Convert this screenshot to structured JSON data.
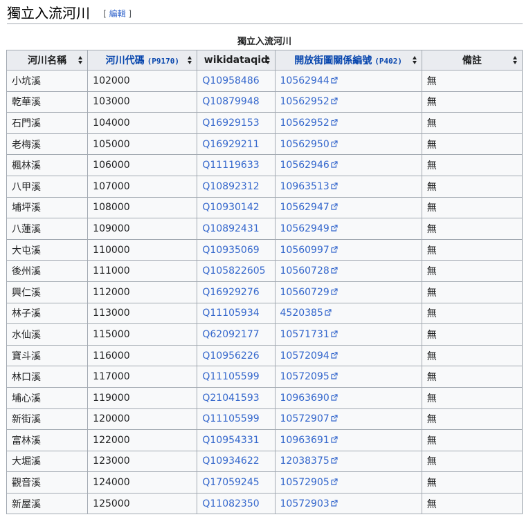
{
  "heading": {
    "title": "獨立入流河川",
    "edit_open": "[ ",
    "edit_label": "編輯",
    "edit_close": " ]"
  },
  "table": {
    "caption": "獨立入流河川",
    "headers": [
      {
        "label": "河川名稱",
        "code": ""
      },
      {
        "label": "河川代碼",
        "code": "(P9170)"
      },
      {
        "label": "wikidataqid",
        "code": ""
      },
      {
        "label": "開放街圖關係編號",
        "code": "(P402)"
      },
      {
        "label": "備註",
        "code": ""
      }
    ],
    "rows": [
      {
        "name": "小坑溪",
        "code": "102000",
        "qid": "Q10958486",
        "osm": "10562944",
        "note": "無"
      },
      {
        "name": "乾華溪",
        "code": "103000",
        "qid": "Q10879948",
        "osm": "10562952",
        "note": "無"
      },
      {
        "name": "石門溪",
        "code": "104000",
        "qid": "Q16929153",
        "osm": "10562952",
        "note": "無"
      },
      {
        "name": "老梅溪",
        "code": "105000",
        "qid": "Q16929211",
        "osm": "10562950",
        "note": "無"
      },
      {
        "name": "楓林溪",
        "code": "106000",
        "qid": "Q11119633",
        "osm": "10562946",
        "note": "無"
      },
      {
        "name": "八甲溪",
        "code": "107000",
        "qid": "Q10892312",
        "osm": "10963513",
        "note": "無"
      },
      {
        "name": "埔坪溪",
        "code": "108000",
        "qid": "Q10930142",
        "osm": "10562947",
        "note": "無"
      },
      {
        "name": "八蓮溪",
        "code": "109000",
        "qid": "Q10892431",
        "osm": "10562949",
        "note": "無"
      },
      {
        "name": "大屯溪",
        "code": "110000",
        "qid": "Q10935069",
        "osm": "10560997",
        "note": "無"
      },
      {
        "name": "後州溪",
        "code": "111000",
        "qid": "Q105822605",
        "osm": "10560728",
        "note": "無"
      },
      {
        "name": "興仁溪",
        "code": "112000",
        "qid": "Q16929276",
        "osm": "10560729",
        "note": "無"
      },
      {
        "name": "林子溪",
        "code": "113000",
        "qid": "Q11105934",
        "osm": "4520385",
        "note": "無"
      },
      {
        "name": "水仙溪",
        "code": "115000",
        "qid": "Q62092177",
        "osm": "10571731",
        "note": "無"
      },
      {
        "name": "寶斗溪",
        "code": "116000",
        "qid": "Q10956226",
        "osm": "10572094",
        "note": "無"
      },
      {
        "name": "林口溪",
        "code": "117000",
        "qid": "Q11105599",
        "osm": "10572095",
        "note": "無"
      },
      {
        "name": "埔心溪",
        "code": "119000",
        "qid": "Q21041593",
        "osm": "10963690",
        "note": "無"
      },
      {
        "name": "新街溪",
        "code": "120000",
        "qid": "Q11105599",
        "osm": "10572907",
        "note": "無"
      },
      {
        "name": "富林溪",
        "code": "122000",
        "qid": "Q10954331",
        "osm": "10963691",
        "note": "無"
      },
      {
        "name": "大堀溪",
        "code": "123000",
        "qid": "Q10934622",
        "osm": "12038375",
        "note": "無"
      },
      {
        "name": "觀音溪",
        "code": "124000",
        "qid": "Q17059245",
        "osm": "10572905",
        "note": "無"
      },
      {
        "name": "新屋溪",
        "code": "125000",
        "qid": "Q11082350",
        "osm": "10572903",
        "note": "無"
      }
    ]
  },
  "icons": {
    "sort": "sort-arrows-icon",
    "external": "external-link-icon"
  },
  "colors": {
    "link": "#3366cc",
    "header_link": "#0645ad",
    "header_bg": "#eaecf0",
    "border": "#a2a9b1"
  }
}
